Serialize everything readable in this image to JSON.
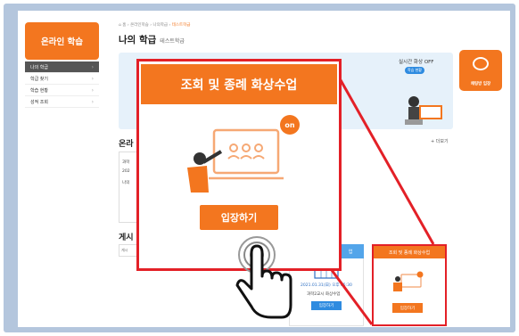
{
  "sidebar": {
    "title": "온라인 학습",
    "items": [
      {
        "label": "나의 학급",
        "active": true
      },
      {
        "label": "학급 찾기",
        "active": false
      },
      {
        "label": "학습 현황",
        "active": false
      },
      {
        "label": "성적 조회",
        "active": false
      }
    ]
  },
  "header": {
    "breadcrumb_home": "홈",
    "breadcrumb_1": "온라인학습",
    "breadcrumb_2": "나의학급",
    "breadcrumb_current": "테스트학급",
    "title": "나의 학급",
    "subtitle": "테스트학급"
  },
  "banner": {
    "live_label": "실시간 화상",
    "live_status": "OFF",
    "live_button": "학습 현황"
  },
  "chat_button": {
    "label": "채팅방 입장"
  },
  "sections": {
    "online_title": "온라",
    "more_label": "+ 더보기",
    "board_title": "게시",
    "board_input": "게시"
  },
  "left_card": {
    "l1": "과학",
    "l2": "202",
    "l3": "나의"
  },
  "lower_card": {
    "tag": "업",
    "date": "2021.01.31(日) 오후 05:30",
    "class": "과학2교시 화상수업",
    "enter": "입장하기"
  },
  "small_card": {
    "title": "조회 및 종례 화상수업",
    "enter": "입장하기"
  },
  "zoom": {
    "title": "조회 및 종례 화상수업",
    "badge": "on",
    "enter": "입장하기"
  },
  "colors": {
    "accent": "#f3761f",
    "highlight": "#e32027",
    "blue": "#2e8be0",
    "banner": "#e6f1fa"
  }
}
